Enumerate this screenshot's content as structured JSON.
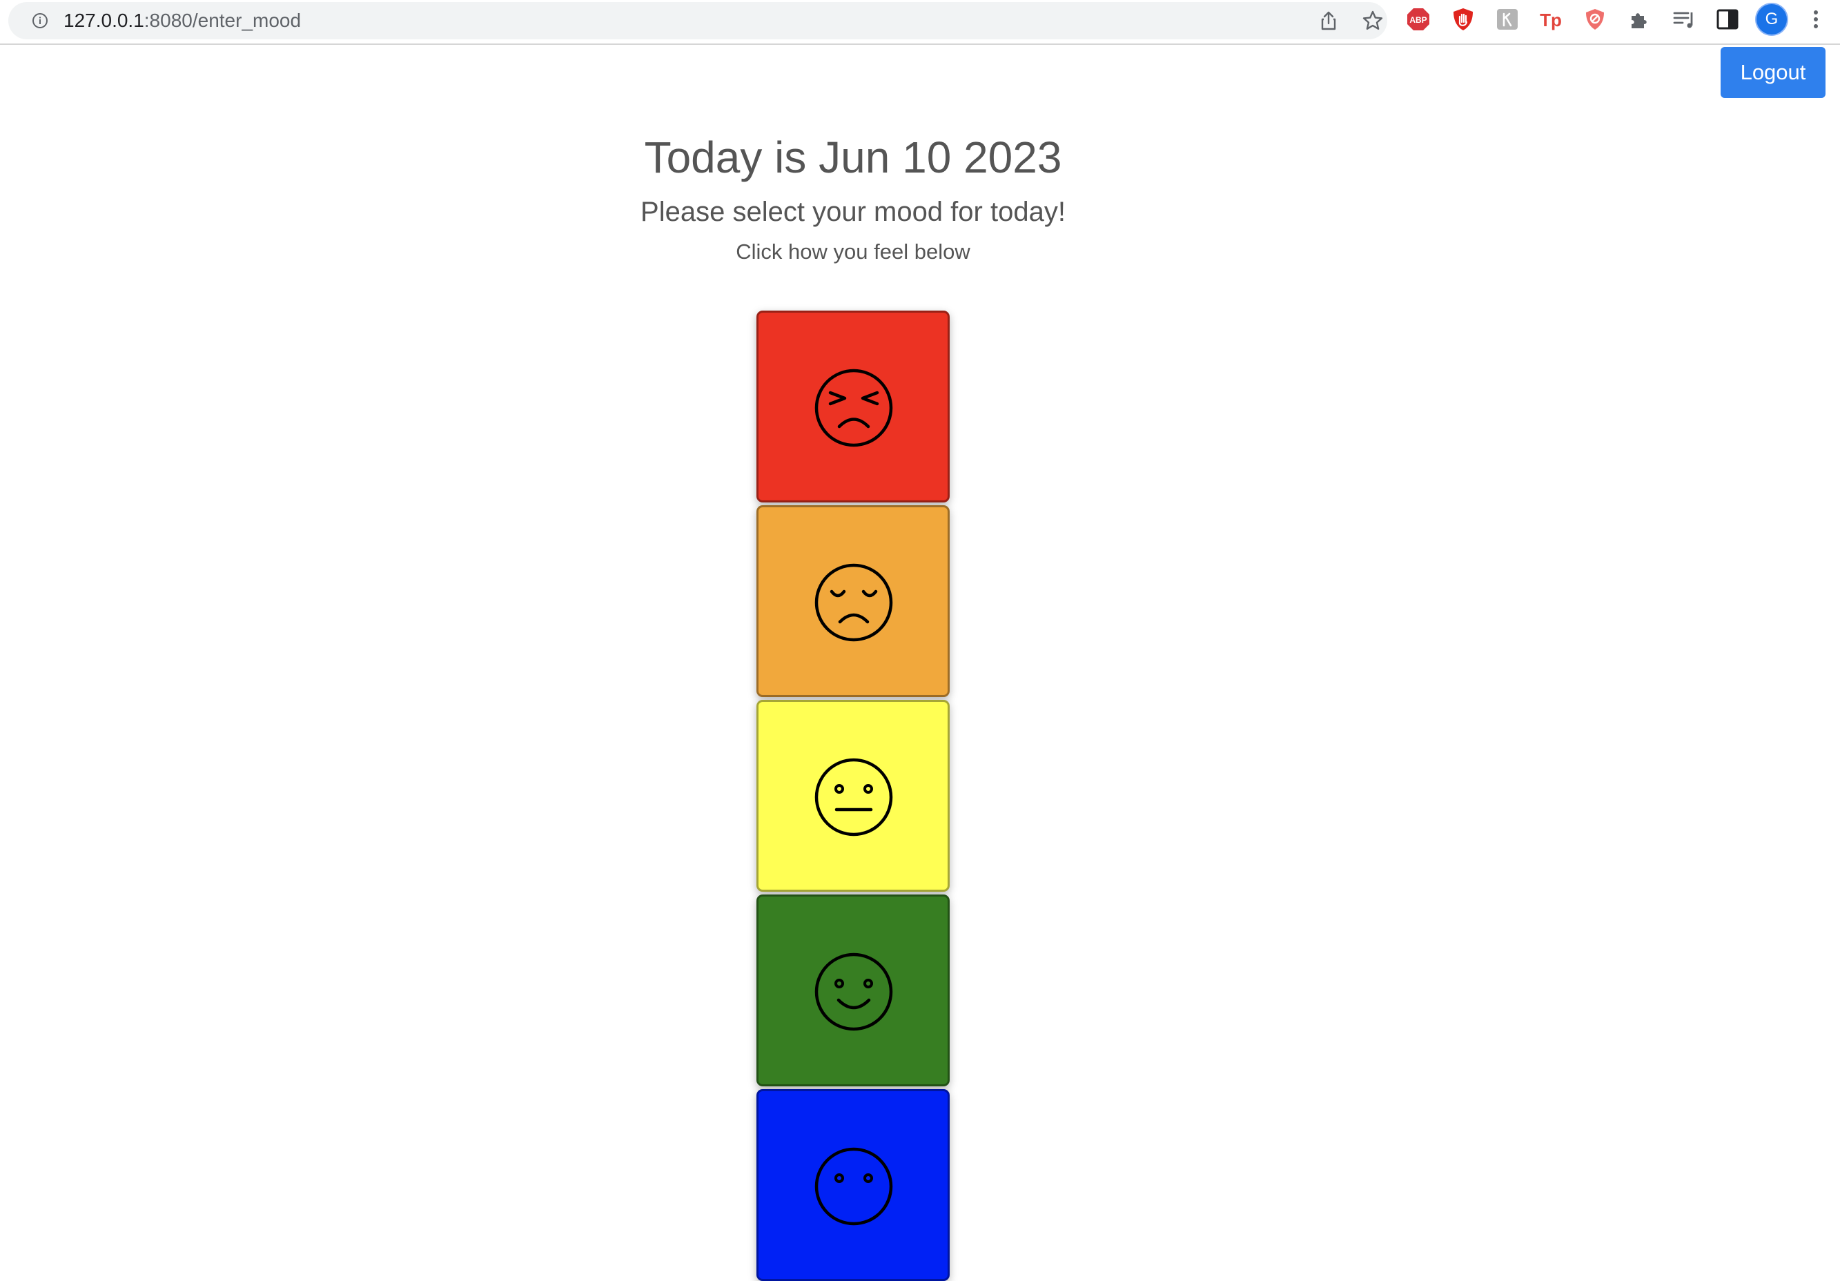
{
  "browser": {
    "url_host": "127.0.0.1",
    "url_path": ":8080/enter_mood",
    "profile_initial": "G",
    "extension_abp_label": "ABP",
    "extension_tp_label": "Tp"
  },
  "header": {
    "logout_label": "Logout"
  },
  "main": {
    "title": "Today is Jun 10 2023",
    "subtitle": "Please select your mood for today!",
    "instruction": "Click how you feel below"
  },
  "moods": [
    {
      "icon": "angry-face-icon",
      "color": "#ec3323"
    },
    {
      "icon": "sad-face-icon",
      "color": "#f1a83c"
    },
    {
      "icon": "neutral-face-icon",
      "color": "#ffff54"
    },
    {
      "icon": "smiling-face-icon",
      "color": "#377e22"
    },
    {
      "icon": "face-icon",
      "color": "#0021f5"
    }
  ],
  "colors": {
    "accent": "#2f80ed",
    "text": "#555555"
  }
}
